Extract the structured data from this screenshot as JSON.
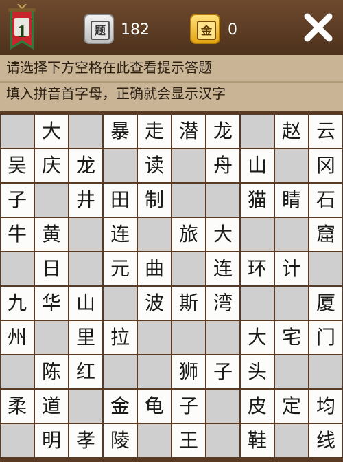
{
  "header": {
    "level": "1",
    "question_icon_glyph": "题",
    "question_count": "182",
    "gold_icon_glyph": "金",
    "gold_count": "0",
    "icons": [
      "level-banner-icon",
      "question-tile-icon",
      "gold-tile-icon",
      "close-icon"
    ],
    "colors": {
      "banner_red": "#c8242b",
      "banner_green": "#2e7a3a",
      "gold": "#f2c230",
      "panel": "#c9b596",
      "board_bg": "#5a3a22"
    }
  },
  "hint": {
    "line1": "请选择下方空格在此查看提示答题",
    "line2": "填入拼音首字母，正确就会显示汉字"
  },
  "grid": {
    "rows": [
      [
        "",
        "大",
        "",
        "暴",
        "走",
        "潜",
        "龙",
        "",
        "赵",
        "云"
      ],
      [
        "吴",
        "庆",
        "龙",
        "",
        "读",
        "",
        "舟",
        "山",
        "",
        "冈"
      ],
      [
        "子",
        "",
        "井",
        "田",
        "制",
        "",
        "",
        "猫",
        "睛",
        "石"
      ],
      [
        "牛",
        "黄",
        "",
        "连",
        "",
        "旅",
        "大",
        "",
        "",
        "窟"
      ],
      [
        "",
        "日",
        "",
        "元",
        "曲",
        "",
        "连",
        "环",
        "计",
        ""
      ],
      [
        "九",
        "华",
        "山",
        "",
        "波",
        "斯",
        "湾",
        "",
        "",
        "厦"
      ],
      [
        "州",
        "",
        "里",
        "拉",
        "",
        "",
        "",
        "大",
        "宅",
        "门"
      ],
      [
        "",
        "陈",
        "红",
        "",
        "",
        "狮",
        "子",
        "头",
        "",
        ""
      ],
      [
        "柔",
        "道",
        "",
        "金",
        "龟",
        "子",
        "",
        "皮",
        "定",
        "均"
      ],
      [
        "",
        "明",
        "孝",
        "陵",
        "",
        "王",
        "",
        "鞋",
        "",
        "线"
      ]
    ]
  }
}
